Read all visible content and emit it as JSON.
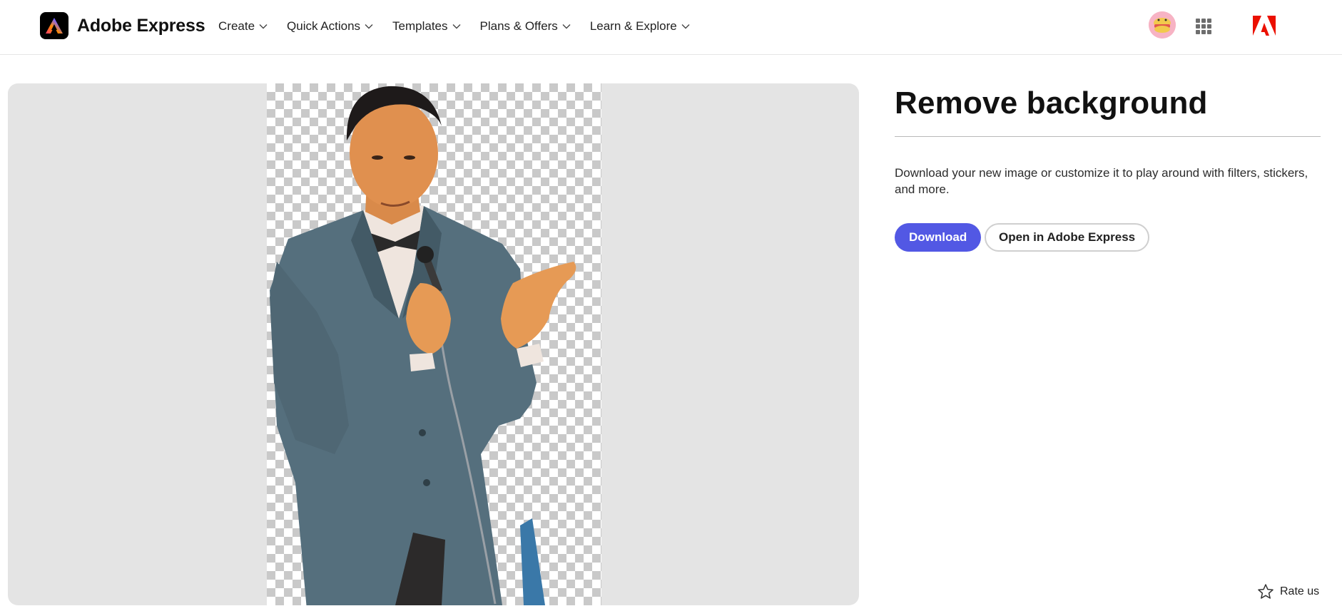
{
  "header": {
    "brand_name": "Adobe Express",
    "nav": [
      {
        "label": "Create"
      },
      {
        "label": "Quick Actions"
      },
      {
        "label": "Templates"
      },
      {
        "label": "Plans & Offers"
      },
      {
        "label": "Learn & Explore"
      }
    ]
  },
  "main": {
    "title": "Remove background",
    "description": "Download your new image or customize it to play around with filters, stickers, and more.",
    "download_label": "Download",
    "open_label": "Open in Adobe Express"
  },
  "footer": {
    "rate_label": "Rate us"
  },
  "colors": {
    "accent": "#5258e4",
    "preview_bg": "#e4e4e4",
    "adobe_red": "#eb1000"
  },
  "icons": {
    "chevron": "chevron-down-icon",
    "apps": "app-grid-icon",
    "adobe": "adobe-logo-icon",
    "rate": "star-outline-icon"
  }
}
